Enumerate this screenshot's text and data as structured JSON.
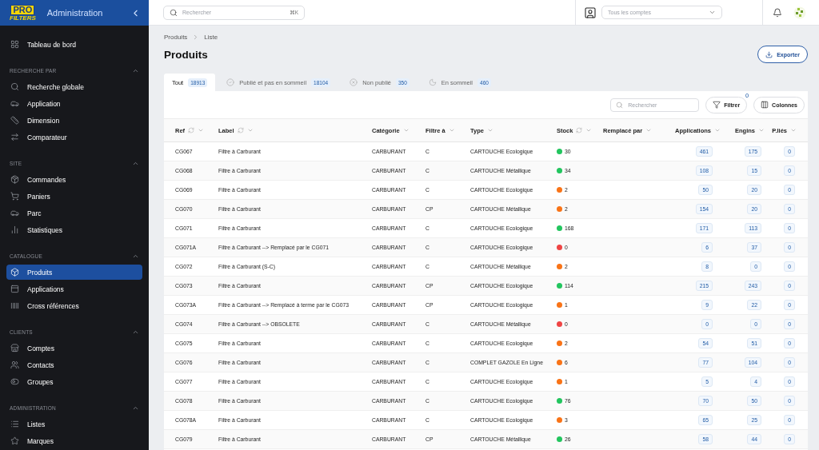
{
  "sidebar": {
    "logo": {
      "top": "PRO",
      "bottom": "FILTERS"
    },
    "title": "Administration",
    "top_items": [
      {
        "label": "Tableau de bord",
        "selected": false
      }
    ],
    "sections": [
      {
        "title": "RECHERCHE PAR",
        "expanded": true,
        "items": [
          {
            "label": "Recherche globale",
            "selected": false
          },
          {
            "label": "Application",
            "selected": false
          },
          {
            "label": "Dimension",
            "selected": false
          },
          {
            "label": "Comparateur",
            "selected": false
          }
        ]
      },
      {
        "title": "SITE",
        "expanded": true,
        "items": [
          {
            "label": "Commandes",
            "selected": false
          },
          {
            "label": "Paniers",
            "selected": false
          },
          {
            "label": "Parc",
            "selected": false
          },
          {
            "label": "Statistiques",
            "selected": false
          }
        ]
      },
      {
        "title": "CATALOGUE",
        "expanded": true,
        "items": [
          {
            "label": "Produits",
            "selected": true
          },
          {
            "label": "Applications",
            "selected": false
          },
          {
            "label": "Cross références",
            "selected": false
          }
        ]
      },
      {
        "title": "CLIENTS",
        "expanded": true,
        "items": [
          {
            "label": "Comptes",
            "selected": false
          },
          {
            "label": "Contacts",
            "selected": false
          },
          {
            "label": "Groupes",
            "selected": false
          }
        ]
      },
      {
        "title": "ADMINISTRATION",
        "expanded": true,
        "items": [
          {
            "label": "Listes",
            "selected": false
          },
          {
            "label": "Marques",
            "selected": false
          }
        ]
      }
    ]
  },
  "topbar": {
    "search": {
      "placeholder": "Rechercher",
      "shortcut": "⌘K"
    },
    "account_select": {
      "placeholder": "Tous les comptes"
    }
  },
  "breadcrumb": [
    "Produits",
    "Liste"
  ],
  "page_title": "Produits",
  "export_button": "Exporter",
  "tabs": [
    {
      "label": "Tout",
      "count": "18913",
      "selected": true
    },
    {
      "label": "Publié et pas en sommeil",
      "count": "18104",
      "selected": false
    },
    {
      "label": "Non publié",
      "count": "350",
      "selected": false
    },
    {
      "label": "En sommeil",
      "count": "460",
      "selected": false
    }
  ],
  "toolbar": {
    "search": {
      "placeholder": "Rechercher"
    },
    "filter_button": "Filtrer",
    "filter_count": "0",
    "columns_button": "Colonnes"
  },
  "table": {
    "columns": [
      {
        "label": "Ref",
        "refresh": true
      },
      {
        "label": "Label",
        "refresh": true
      },
      {
        "label": "Catégorie",
        "refresh": false
      },
      {
        "label": "Filtre à",
        "refresh": false
      },
      {
        "label": "Type",
        "refresh": false
      },
      {
        "label": "Stock",
        "refresh": true
      },
      {
        "label": "Remplacé par",
        "refresh": false
      },
      {
        "label": "Applications",
        "refresh": false
      },
      {
        "label": "Engins",
        "refresh": false
      },
      {
        "label": "P.liés",
        "refresh": false
      }
    ],
    "rows": [
      {
        "ref": "CG067",
        "label": "Filtre à Carburant",
        "category": "CARBURANT",
        "filter": "C",
        "type": "CARTOUCHE Ecologique",
        "stock": "30",
        "color": "#22c55e",
        "applications": "461",
        "engins": "175",
        "linked": "0"
      },
      {
        "ref": "CG068",
        "label": "Filtre à Carburant",
        "category": "CARBURANT",
        "filter": "C",
        "type": "CARTOUCHE Métallique",
        "stock": "34",
        "color": "#22c55e",
        "applications": "108",
        "engins": "15",
        "linked": "0"
      },
      {
        "ref": "CG069",
        "label": "Filtre à Carburant",
        "category": "CARBURANT",
        "filter": "C",
        "type": "CARTOUCHE Ecologique",
        "stock": "2",
        "color": "#f97316",
        "applications": "50",
        "engins": "20",
        "linked": "0"
      },
      {
        "ref": "CG070",
        "label": "Filtre à Carburant",
        "category": "CARBURANT",
        "filter": "CP",
        "type": "CARTOUCHE Métallique",
        "stock": "2",
        "color": "#f97316",
        "applications": "154",
        "engins": "20",
        "linked": "0"
      },
      {
        "ref": "CG071",
        "label": "Filtre à Carburant",
        "category": "CARBURANT",
        "filter": "C",
        "type": "CARTOUCHE Ecologique",
        "stock": "168",
        "color": "#22c55e",
        "applications": "171",
        "engins": "113",
        "linked": "0"
      },
      {
        "ref": "CG071A",
        "label": "Filtre à Carburant --> Remplacé par le CG071",
        "category": "CARBURANT",
        "filter": "C",
        "type": "CARTOUCHE Ecologique",
        "stock": "0",
        "color": "#ef4444",
        "applications": "6",
        "engins": "37",
        "linked": "0"
      },
      {
        "ref": "CG072",
        "label": "Filtre à Carburant (S-C)",
        "category": "CARBURANT",
        "filter": "C",
        "type": "CARTOUCHE Métallique",
        "stock": "2",
        "color": "#f97316",
        "applications": "8",
        "engins": "0",
        "linked": "0"
      },
      {
        "ref": "CG073",
        "label": "Filtre à Carburant",
        "category": "CARBURANT",
        "filter": "CP",
        "type": "CARTOUCHE Ecologique",
        "stock": "114",
        "color": "#22c55e",
        "applications": "215",
        "engins": "243",
        "linked": "0"
      },
      {
        "ref": "CG073A",
        "label": "Filtre à Carburant --> Remplacé à terme par le CG073",
        "category": "CARBURANT",
        "filter": "CP",
        "type": "CARTOUCHE Ecologique",
        "stock": "1",
        "color": "#f97316",
        "applications": "9",
        "engins": "22",
        "linked": "0"
      },
      {
        "ref": "CG074",
        "label": "Filtre à Carburant --> OBSOLETE",
        "category": "CARBURANT",
        "filter": "C",
        "type": "CARTOUCHE Métallique",
        "stock": "0",
        "color": "#ef4444",
        "applications": "0",
        "engins": "0",
        "linked": "0"
      },
      {
        "ref": "CG075",
        "label": "Filtre à Carburant",
        "category": "CARBURANT",
        "filter": "C",
        "type": "CARTOUCHE Ecologique",
        "stock": "2",
        "color": "#f97316",
        "applications": "54",
        "engins": "51",
        "linked": "0"
      },
      {
        "ref": "CG076",
        "label": "Filtre à Carburant",
        "category": "CARBURANT",
        "filter": "C",
        "type": "COMPLET GAZOLE En Ligne",
        "stock": "6",
        "color": "#f97316",
        "applications": "77",
        "engins": "104",
        "linked": "0"
      },
      {
        "ref": "CG077",
        "label": "Filtre à Carburant",
        "category": "CARBURANT",
        "filter": "C",
        "type": "CARTOUCHE Ecologique",
        "stock": "1",
        "color": "#f97316",
        "applications": "5",
        "engins": "4",
        "linked": "0"
      },
      {
        "ref": "CG078",
        "label": "Filtre à Carburant",
        "category": "CARBURANT",
        "filter": "C",
        "type": "CARTOUCHE Ecologique",
        "stock": "76",
        "color": "#22c55e",
        "applications": "70",
        "engins": "50",
        "linked": "0"
      },
      {
        "ref": "CG078A",
        "label": "Filtre à Carburant",
        "category": "CARBURANT",
        "filter": "C",
        "type": "CARTOUCHE Ecologique",
        "stock": "3",
        "color": "#f97316",
        "applications": "65",
        "engins": "25",
        "linked": "0"
      },
      {
        "ref": "CG079",
        "label": "Filtre à Carburant",
        "category": "CARBURANT",
        "filter": "CP",
        "type": "CARTOUCHE Métallique",
        "stock": "26",
        "color": "#22c55e",
        "applications": "58",
        "engins": "44",
        "linked": "0"
      }
    ]
  }
}
